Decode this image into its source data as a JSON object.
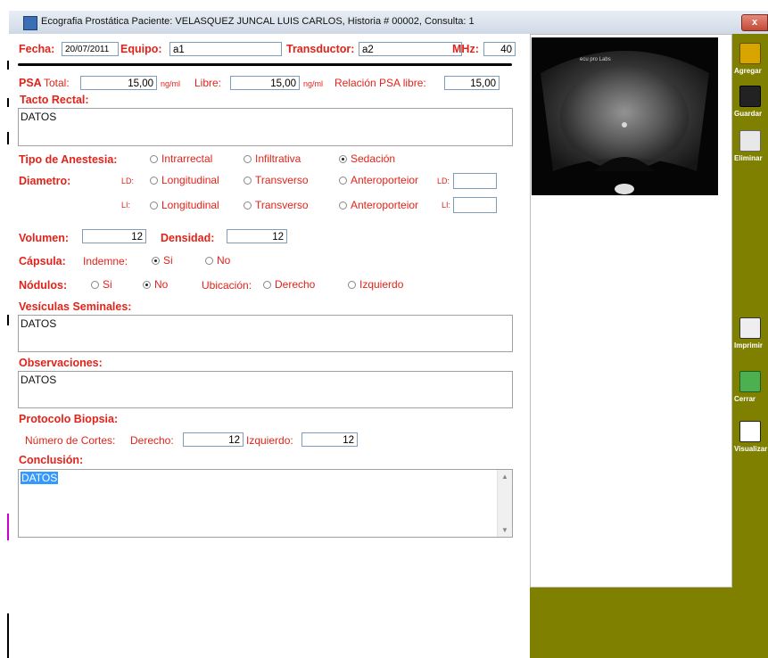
{
  "window": {
    "title": "Ecografia Prostática  Paciente: VELASQUEZ JUNCAL LUIS CARLOS, Historia # 00002, Consulta: 1",
    "close_label": "x"
  },
  "header": {
    "fecha_label": "Fecha:",
    "fecha_value": "20/07/2011",
    "equipo_label": "Equipo:",
    "equipo_value": "a1",
    "transductor_label": "Transductor:",
    "transductor_value": "a2",
    "mhz_label": "MHz:",
    "mhz_value": "40"
  },
  "psa": {
    "label": "PSA",
    "total_label": "Total:",
    "total_value": "15,00",
    "unit1": "ng/ml",
    "libre_label": "Libre:",
    "libre_value": "15,00",
    "unit2": "ng/ml",
    "relacion_label": "Relación PSA libre:",
    "relacion_value": "15,00"
  },
  "tacto": {
    "label": "Tacto Rectal:",
    "value": "DATOS"
  },
  "anestesia": {
    "label": "Tipo de Anestesia:",
    "options": [
      "Intrarrectal",
      "Infiltrativa",
      "Sedación"
    ],
    "selected": "Sedación"
  },
  "diametro": {
    "label": "Diametro:",
    "ld_label": "LD:",
    "li_label": "LI:",
    "options": [
      "Longitudinal",
      "Transverso",
      "Anteroporteior"
    ],
    "ld_box_label": "LD:",
    "li_box_label": "LI:",
    "ld_value": "",
    "li_value": ""
  },
  "volumen": {
    "label": "Volumen:",
    "value": "12",
    "densidad_label": "Densidad:",
    "densidad_value": "12"
  },
  "capsula": {
    "label": "Cápsula:",
    "indemne_label": "Indemne:",
    "si": "Si",
    "no": "No",
    "selected": "Si"
  },
  "nodulos": {
    "label": "Nódulos:",
    "si": "Si",
    "no": "No",
    "selected": "No",
    "ubicacion_label": "Ubicación:",
    "derecho": "Derecho",
    "izquierdo": "Izquierdo"
  },
  "vesiculas": {
    "label": "Vesículas Seminales:",
    "value": "DATOS"
  },
  "observaciones": {
    "label": "Observaciones:",
    "value": "DATOS"
  },
  "biopsia": {
    "label": "Protocolo Biopsia:",
    "cortes_label": "Número de Cortes:",
    "derecho_label": "Derecho:",
    "derecho_value": "12",
    "izquierdo_label": "Izquierdo:",
    "izquierdo_value": "12"
  },
  "conclusion": {
    "label": "Conclusión:",
    "value": "DATOS"
  },
  "ultrasound": {
    "text_top": "ecu pro Labs"
  },
  "toolbar": {
    "agregar": "Agregar",
    "guardar": "Guardar",
    "eliminar": "Eliminar",
    "imprimir": "Imprimir",
    "cerrar": "Cerrar",
    "visualizar": "Visualizar"
  },
  "colors": {
    "accent": "#e2231a",
    "toolbar_bg": "#808000"
  }
}
